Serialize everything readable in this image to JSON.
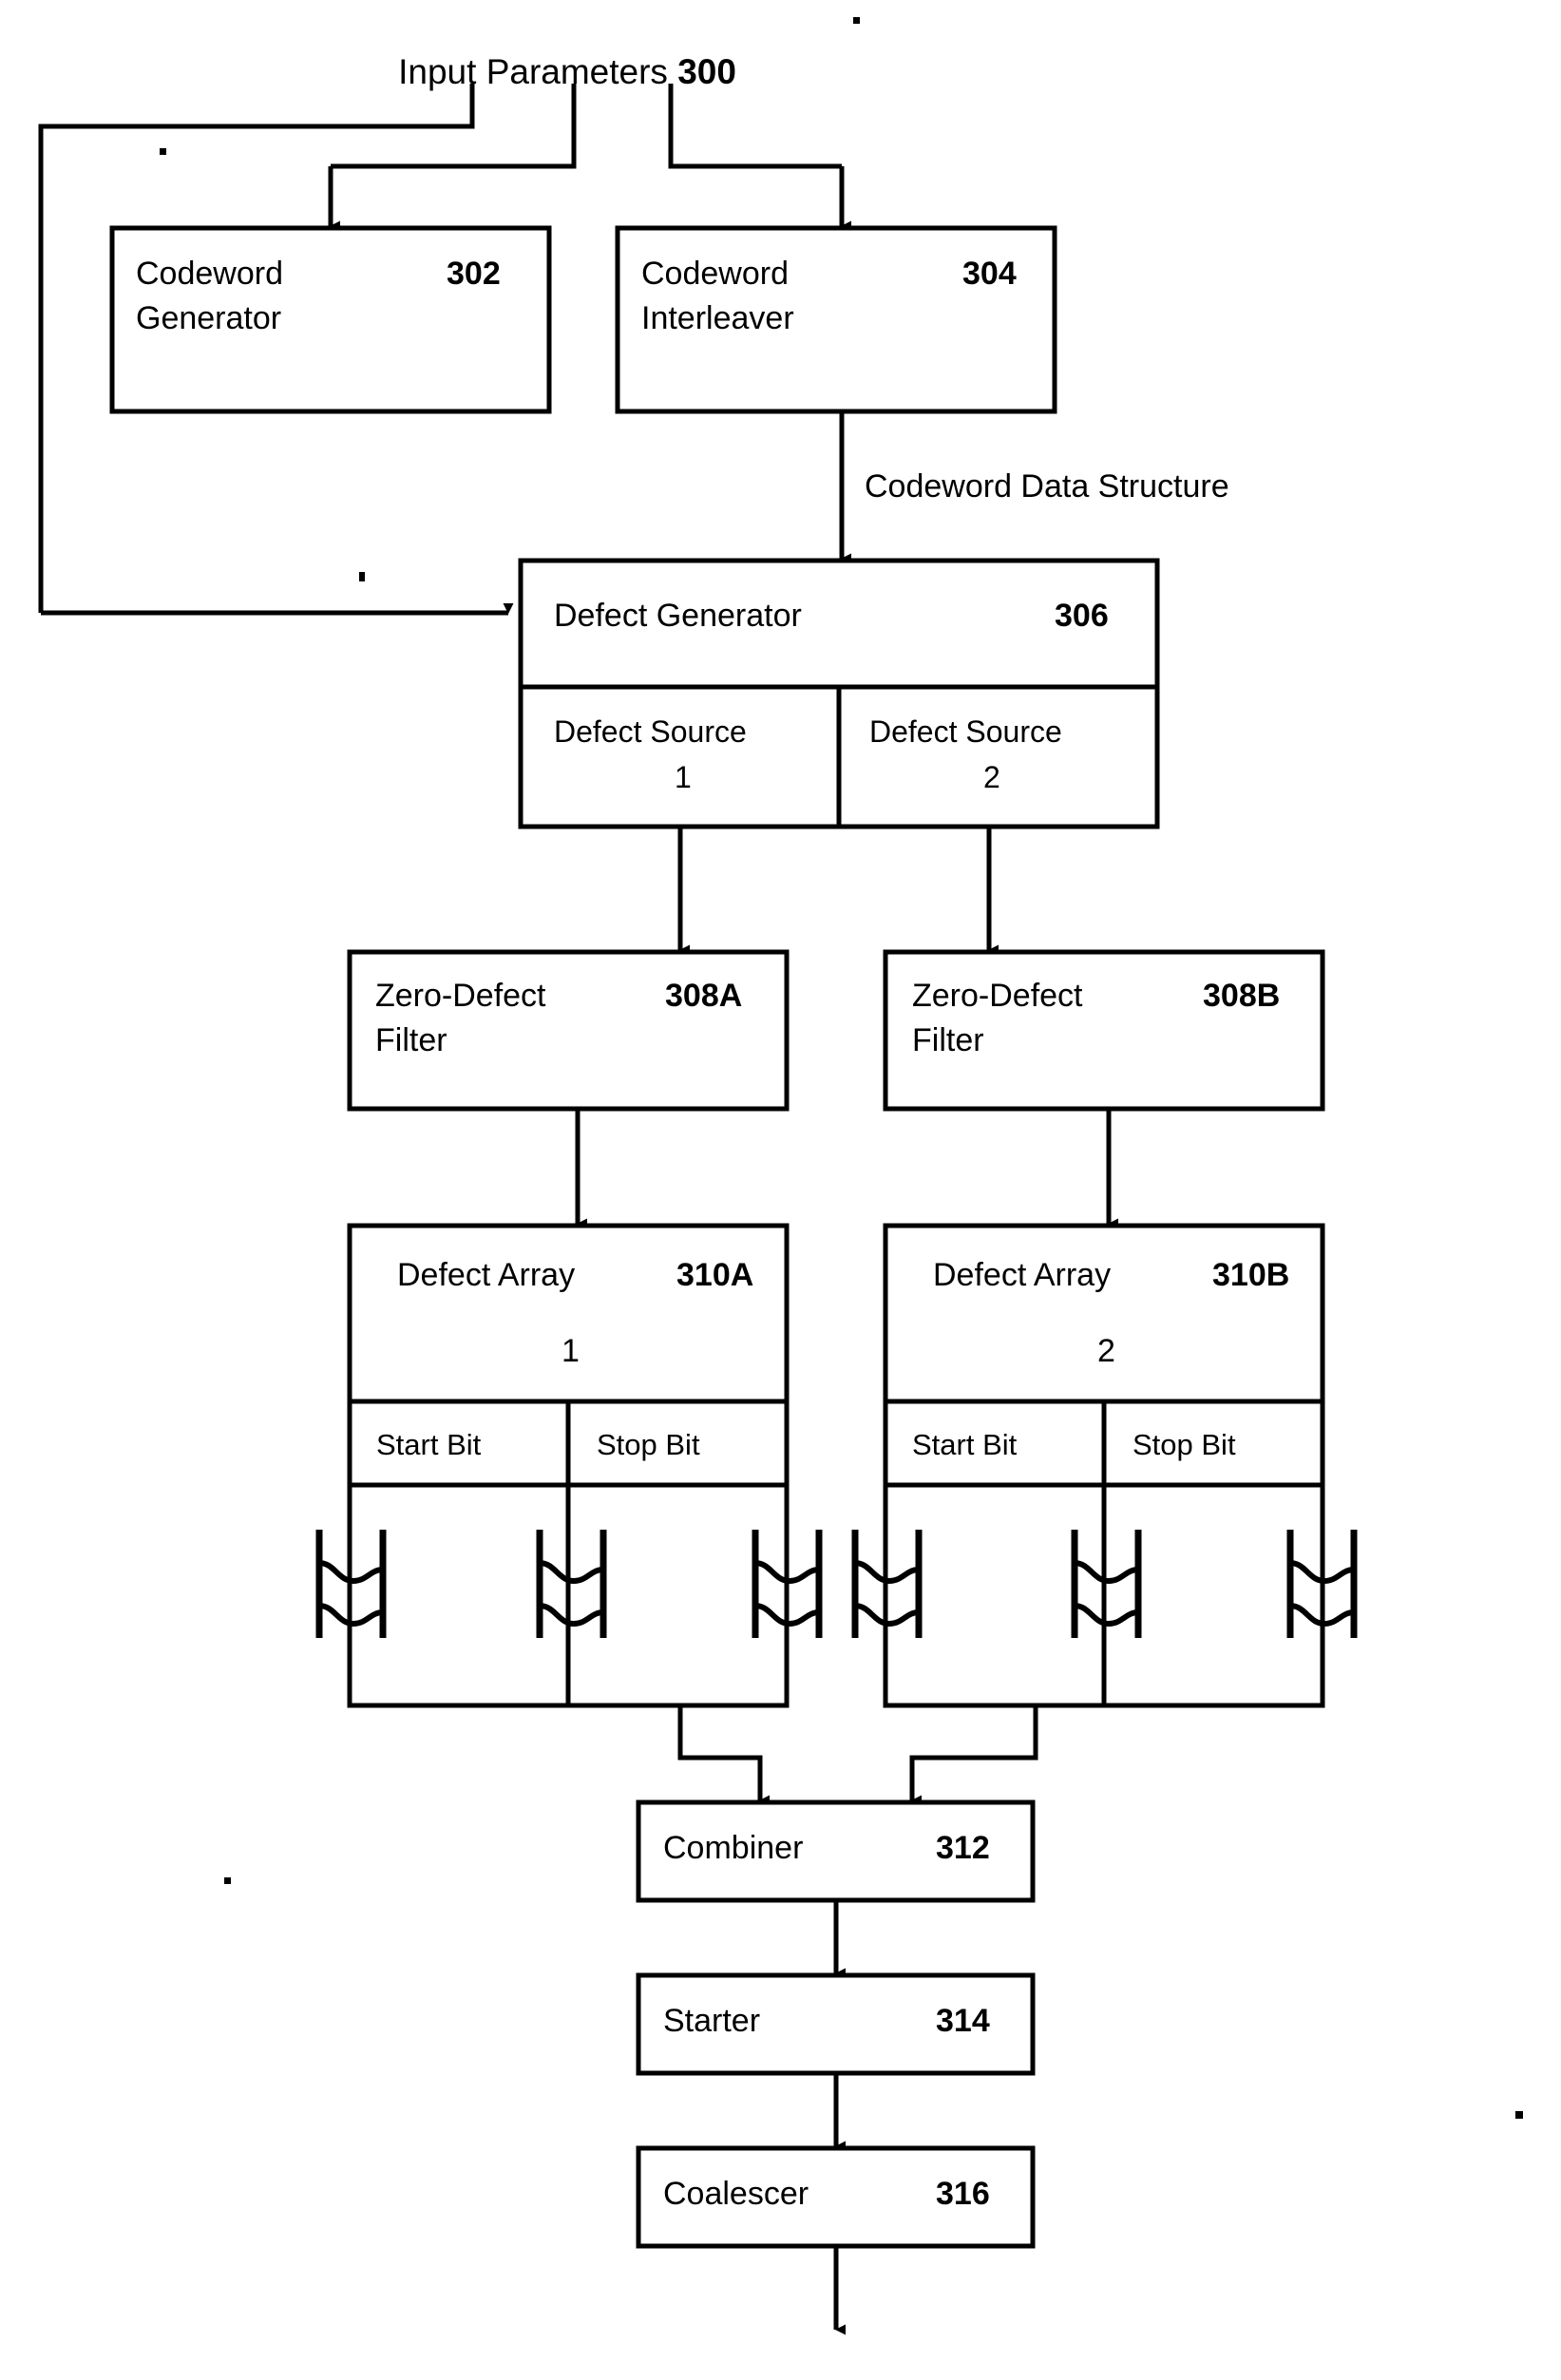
{
  "figure": {
    "title_text": "Input Parameters",
    "title_ref": "300",
    "flow_label": "Codeword Data Structure"
  },
  "blocks": {
    "codeword_generator": {
      "line1": "Codeword",
      "line2": "Generator",
      "ref": "302"
    },
    "codeword_interleaver": {
      "line1": "Codeword",
      "line2": "Interleaver",
      "ref": "304"
    },
    "defect_generator": {
      "label": "Defect Generator",
      "ref": "306"
    },
    "defect_source_1": {
      "line1": "Defect Source",
      "line2": "1"
    },
    "defect_source_2": {
      "line1": "Defect Source",
      "line2": "2"
    },
    "zero_defect_filter_a": {
      "line1": "Zero-Defect",
      "line2": "Filter",
      "ref": "308A"
    },
    "zero_defect_filter_b": {
      "line1": "Zero-Defect",
      "line2": "Filter",
      "ref": "308B"
    },
    "defect_array_a": {
      "label": "Defect Array",
      "ref": "310A",
      "index": "1",
      "col1": "Start Bit",
      "col2": "Stop Bit"
    },
    "defect_array_b": {
      "label": "Defect Array",
      "ref": "310B",
      "index": "2",
      "col1": "Start Bit",
      "col2": "Stop Bit"
    },
    "combiner": {
      "label": "Combiner",
      "ref": "312"
    },
    "starter": {
      "label": "Starter",
      "ref": "314"
    },
    "coalescer": {
      "label": "Coalescer",
      "ref": "316"
    }
  },
  "style": {
    "stroke": "#000000",
    "fill": "#ffffff",
    "background": "#ffffff"
  }
}
